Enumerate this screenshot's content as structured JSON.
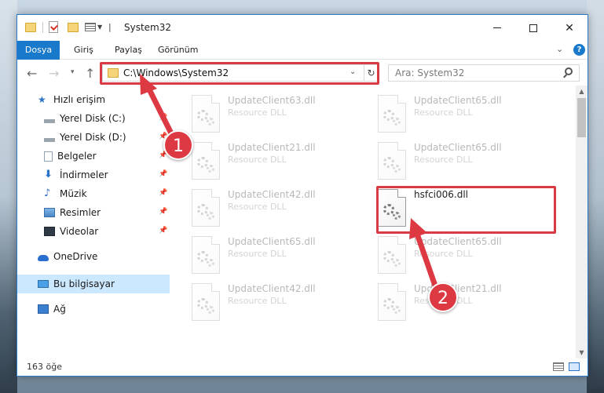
{
  "window": {
    "title": "System32",
    "controls": {
      "minimize": "minimize",
      "maximize": "maximize",
      "close": "close"
    }
  },
  "ribbon": {
    "tabs": [
      {
        "label": "Dosya"
      },
      {
        "label": "Giriş"
      },
      {
        "label": "Paylaş"
      },
      {
        "label": "Görünüm"
      }
    ],
    "help": "?"
  },
  "navbar": {
    "address": "C:\\Windows\\System32",
    "search_placeholder": "Ara: System32"
  },
  "sidebar": {
    "items": [
      {
        "label": "Hızlı erişim",
        "icon": "star-icon"
      },
      {
        "label": "Yerel Disk (C:)",
        "icon": "disk-icon",
        "pinned": true
      },
      {
        "label": "Yerel Disk (D:)",
        "icon": "disk-icon",
        "pinned": true
      },
      {
        "label": "Belgeler",
        "icon": "documents-icon",
        "pinned": true
      },
      {
        "label": "İndirmeler",
        "icon": "download-icon",
        "pinned": true
      },
      {
        "label": "Müzik",
        "icon": "music-icon",
        "pinned": true
      },
      {
        "label": "Resimler",
        "icon": "pictures-icon",
        "pinned": true
      },
      {
        "label": "Videolar",
        "icon": "video-icon",
        "pinned": true
      },
      {
        "label": "OneDrive",
        "icon": "cloud-icon"
      },
      {
        "label": "Bu bilgisayar",
        "icon": "computer-icon",
        "selected": true
      },
      {
        "label": "Ağ",
        "icon": "network-icon"
      }
    ]
  },
  "files": [
    {
      "name": "UpdateClient63.dll",
      "type": "Resource DLL"
    },
    {
      "name": "UpdateClient65.dll",
      "type": "Resource DLL"
    },
    {
      "name": "UpdateClient21.dll",
      "type": "Resource DLL"
    },
    {
      "name": "UpdateClient65.dll",
      "type": "Resource DLL"
    },
    {
      "name": "UpdateClient42.dll",
      "type": "Resource DLL"
    },
    {
      "name": "hsfci006.dll",
      "type": "",
      "highlighted": true
    },
    {
      "name": "UpdateClient65.dll",
      "type": "Resource DLL"
    },
    {
      "name": "UpdateClient65.dll",
      "type": "Resource DLL"
    },
    {
      "name": "UpdateClient42.dll",
      "type": "Resource DLL"
    },
    {
      "name": "UpdateClient21.dll",
      "type": "Resource DLL"
    }
  ],
  "status": {
    "item_count": "163 öğe"
  },
  "callouts": {
    "step1": "1",
    "step2": "2"
  },
  "colors": {
    "accent": "#1979ca",
    "highlight": "#d93a43",
    "selected": "#cce8ff"
  }
}
